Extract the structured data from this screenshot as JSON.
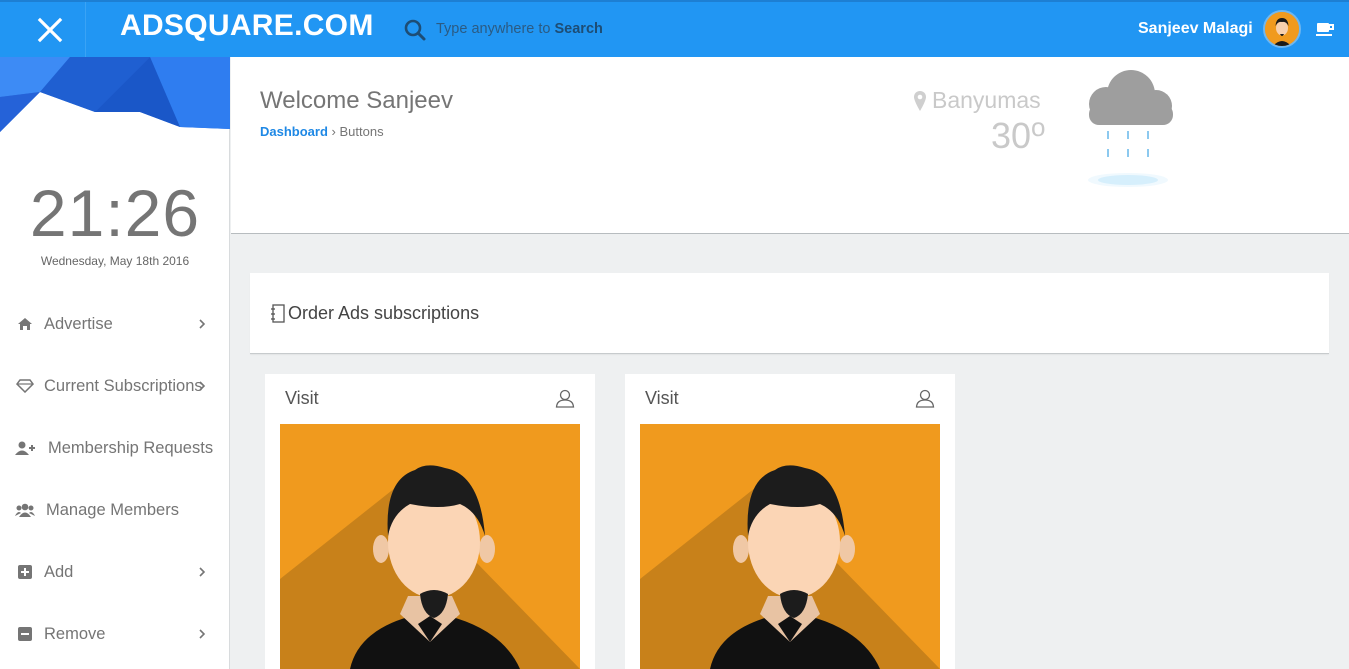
{
  "topbar": {
    "brand": "ADSQUARE.COM",
    "search_placeholder": "",
    "search_hint_prefix": "Type anywhere to ",
    "search_hint_keyword": "Search",
    "user_name": "Sanjeev Malagi",
    "colors": {
      "bar": "#2196f3",
      "text": "#ffffff"
    },
    "icons": [
      "close-icon",
      "search-icon",
      "avatar",
      "coffee-cup-icon"
    ]
  },
  "sidebar": {
    "time": "21:26",
    "date": "Wednesday, May 18th 2016",
    "items": [
      {
        "label": "Advertise",
        "icon": "home-icon",
        "has_chevron": true
      },
      {
        "label": "Current Subscriptions",
        "icon": "diamond-icon",
        "has_chevron": true
      },
      {
        "label": "Membership Requests",
        "icon": "user-plus-icon",
        "has_chevron": false
      },
      {
        "label": "Manage Members",
        "icon": "users-icon",
        "has_chevron": false
      },
      {
        "label": "Add",
        "icon": "plus-square-icon",
        "has_chevron": true
      },
      {
        "label": "Remove",
        "icon": "minus-square-icon",
        "has_chevron": true
      }
    ]
  },
  "header": {
    "welcome": "Welcome Sanjeev",
    "breadcrumb": {
      "link": "Dashboard",
      "separator": "›",
      "current": "Buttons"
    },
    "weather": {
      "city": "Banyumas",
      "temp": "30",
      "unit": "o",
      "condition_icon": "rain-cloud-icon"
    }
  },
  "main": {
    "order_title": "Order Ads subscriptions",
    "cards": [
      {
        "title": "Visit"
      },
      {
        "title": "Visit"
      }
    ]
  }
}
